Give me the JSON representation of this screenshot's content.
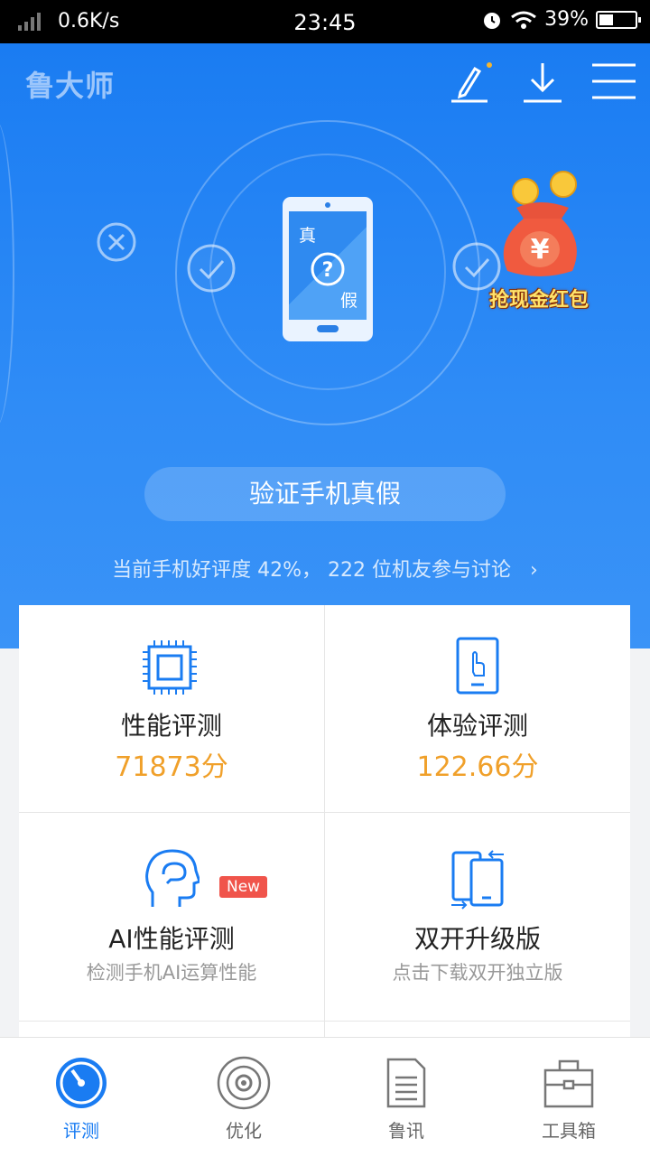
{
  "status_bar": {
    "speed": "0.6K/s",
    "time": "23:45",
    "battery": "39%",
    "battery_level": 0.39
  },
  "header": {
    "app_name": "鲁大师"
  },
  "hero": {
    "phone_text_true": "真",
    "phone_text_fake": "假",
    "red_packet_label": "抢现金红包",
    "verify_button": "验证手机真假",
    "rating_text": "当前手机好评度 42%， 222 位机友参与讨论"
  },
  "cards": {
    "performance": {
      "title": "性能评测",
      "score": "71873分"
    },
    "experience": {
      "title": "体验评测",
      "score": "122.66分"
    },
    "ai": {
      "title": "AI性能评测",
      "subtitle": "检测手机AI运算性能",
      "badge": "New"
    },
    "dual": {
      "title": "双开升级版",
      "subtitle": "点击下载双开独立版"
    }
  },
  "tabs": [
    {
      "label": "评测",
      "active": true
    },
    {
      "label": "优化",
      "active": false
    },
    {
      "label": "鲁讯",
      "active": false
    },
    {
      "label": "工具箱",
      "active": false
    }
  ],
  "colors": {
    "brand_blue": "#1a7cf2",
    "score_orange": "#f0a02a",
    "badge_red": "#f0544b"
  }
}
